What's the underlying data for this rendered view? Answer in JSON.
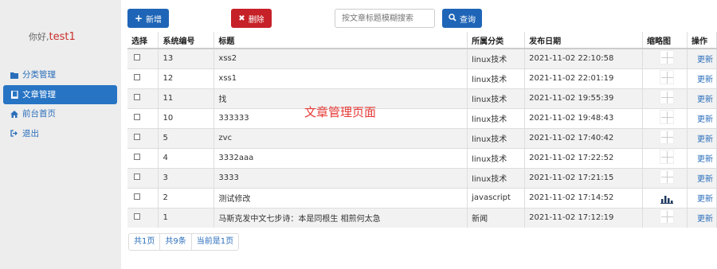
{
  "greeting": {
    "prefix": "你好,",
    "user": "test1"
  },
  "sidebar": {
    "items": [
      {
        "label": "分类管理",
        "icon": "folder-icon"
      },
      {
        "label": "文章管理",
        "icon": "book-icon",
        "active": true
      },
      {
        "label": "前台首页",
        "icon": "home-icon"
      },
      {
        "label": "退出",
        "icon": "logout-icon"
      }
    ]
  },
  "toolbar": {
    "add_label": "新增",
    "delete_label": "删除",
    "search_placeholder": "按文章标题模糊搜索",
    "query_label": "查询"
  },
  "table": {
    "headers": [
      "选择",
      "系统编号",
      "标题",
      "所属分类",
      "发布日期",
      "缩略图",
      "操作"
    ],
    "rows": [
      {
        "id": "13",
        "title": "xss2",
        "category": "linux技术",
        "date": "2021-11-02 22:10:58",
        "action": "更新",
        "thumb": "placeholder"
      },
      {
        "id": "12",
        "title": "xss1",
        "category": "linux技术",
        "date": "2021-11-02 22:01:19",
        "action": "更新",
        "thumb": "placeholder"
      },
      {
        "id": "11",
        "title": "找",
        "category": "linux技术",
        "date": "2021-11-02 19:55:39",
        "action": "更新",
        "thumb": "placeholder"
      },
      {
        "id": "10",
        "title": "333333",
        "category": "linux技术",
        "date": "2021-11-02 19:48:43",
        "action": "更新",
        "thumb": "placeholder"
      },
      {
        "id": "5",
        "title": "zvc",
        "category": "linux技术",
        "date": "2021-11-02 17:40:42",
        "action": "更新",
        "thumb": "placeholder"
      },
      {
        "id": "4",
        "title": "3332aaa",
        "category": "linux技术",
        "date": "2021-11-02 17:22:52",
        "action": "更新",
        "thumb": "placeholder"
      },
      {
        "id": "3",
        "title": "3333",
        "category": "linux技术",
        "date": "2021-11-02 17:21:15",
        "action": "更新",
        "thumb": "placeholder"
      },
      {
        "id": "2",
        "title": "测试修改",
        "category": "javascript",
        "date": "2021-11-02 17:14:52",
        "action": "更新",
        "thumb": "chart"
      },
      {
        "id": "1",
        "title": "马斯克发中文七步诗：本是同根生 相煎何太急",
        "category": "新闻",
        "date": "2021-11-02 17:12:19",
        "action": "更新",
        "thumb": "placeholder"
      }
    ]
  },
  "overlay_label": "文章管理页面",
  "pager": {
    "total_pages": "共1页",
    "total_items": "共9条",
    "current": "当前是1页"
  },
  "colors": {
    "primary": "#1f65b7",
    "danger": "#c62128",
    "link": "#2a6ebb",
    "overlay": "#e53935"
  }
}
